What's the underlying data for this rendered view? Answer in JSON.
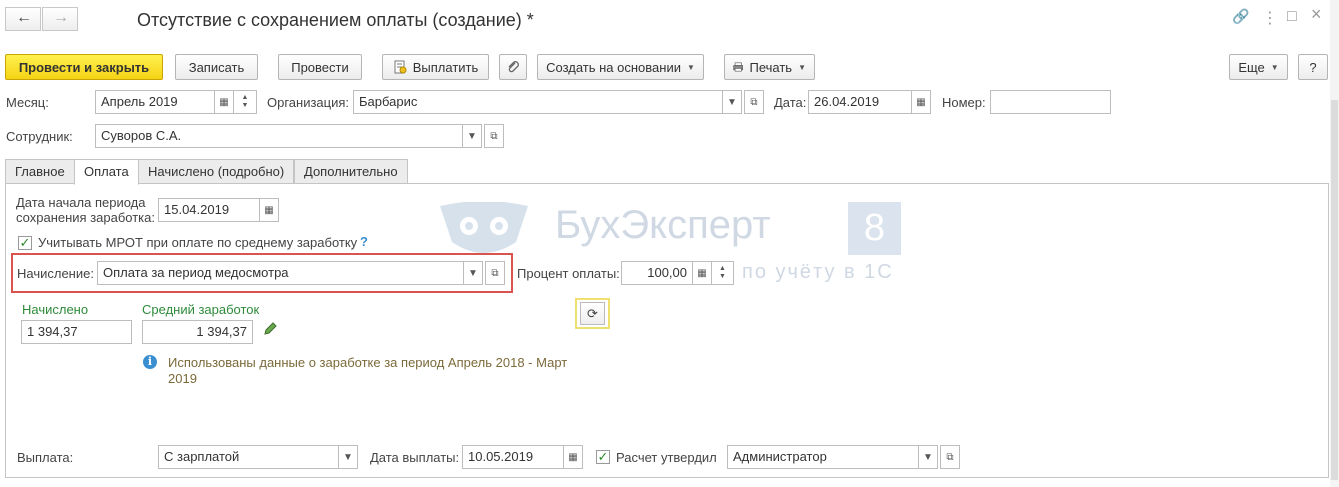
{
  "window": {
    "title": "Отсутствие с сохранением оплаты (создание) *",
    "back_icon": "←",
    "forward_icon": "→",
    "link_icon": "🔗",
    "more_icon": "⋮",
    "maximize_icon": "□",
    "close_icon": "×"
  },
  "toolbar": {
    "post_close": "Провести и закрыть",
    "save": "Записать",
    "post": "Провести",
    "pay": "Выплатить",
    "create_based": "Создать на основании",
    "print": "Печать",
    "more": "Еще",
    "help": "?"
  },
  "header": {
    "month_label": "Месяц:",
    "month_value": "Апрель 2019",
    "org_label": "Организация:",
    "org_value": "Барбарис",
    "date_label": "Дата:",
    "date_value": "26.04.2019",
    "number_label": "Номер:",
    "number_value": "",
    "employee_label": "Сотрудник:",
    "employee_value": "Суворов С.А."
  },
  "tabs": [
    "Главное",
    "Оплата",
    "Начислено (подробно)",
    "Дополнительно"
  ],
  "payment": {
    "period_start_label_1": "Дата начала периода",
    "period_start_label_2": "сохранения заработка:",
    "period_start_value": "15.04.2019",
    "mrot_label": "Учитывать МРОТ при оплате по среднему заработку",
    "mrot_help": "?",
    "accrual_label": "Начисление:",
    "accrual_value": "Оплата за период медосмотра",
    "percent_label": "Процент оплаты:",
    "percent_value": "100,00",
    "accrued_label": "Начислено",
    "accrued_value": "1 394,37",
    "avg_label": "Средний заработок",
    "avg_value": "1 394,37",
    "info_1": "Использованы данные о заработке за период Апрель 2018 - Март",
    "info_2": "2019"
  },
  "footer": {
    "payout_label": "Выплата:",
    "payout_value": "С зарплатой",
    "payout_date_label": "Дата выплаты:",
    "payout_date_value": "10.05.2019",
    "approved_label": "Расчет утвердил",
    "approved_value": "Администратор"
  },
  "watermark": {
    "brand": "БухЭксперт",
    "brand_digit": "8",
    "tagline": "по учёту в 1С"
  },
  "colors": {
    "accent_yellow": "#f5d314",
    "highlight_red": "#d9534f",
    "label_green": "#2e8b3a",
    "info_blue": "#3a8fd0"
  }
}
